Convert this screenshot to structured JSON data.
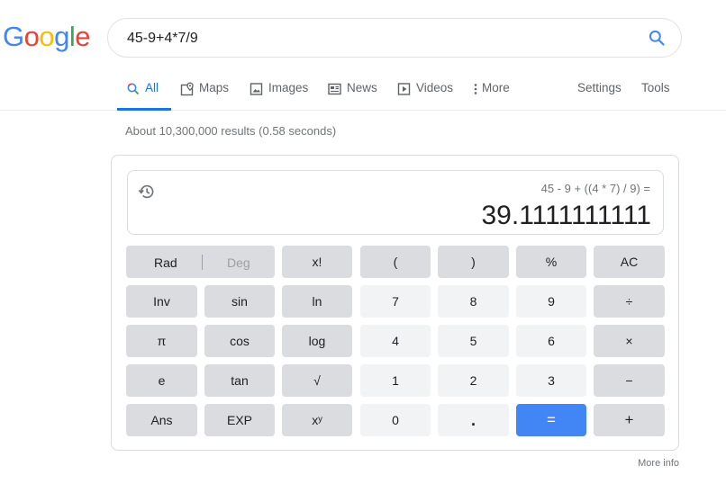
{
  "logo": {
    "letters": [
      "G",
      "o",
      "o",
      "g",
      "l",
      "e"
    ],
    "colors": [
      "#4285f4",
      "#ea4335",
      "#fbbc05",
      "#4285f4",
      "#34a853",
      "#ea4335"
    ]
  },
  "search": {
    "query": "45-9+4*7/9"
  },
  "tabs": [
    {
      "label": "All",
      "icon": "search-icon"
    },
    {
      "label": "Maps",
      "icon": "map-pin-icon"
    },
    {
      "label": "Images",
      "icon": "image-icon"
    },
    {
      "label": "News",
      "icon": "news-icon"
    },
    {
      "label": "Videos",
      "icon": "video-icon"
    },
    {
      "label": "More",
      "icon": "more-vert-icon"
    }
  ],
  "settings_label": "Settings",
  "tools_label": "Tools",
  "stats": "About 10,300,000 results (0.58 seconds)",
  "calculator": {
    "expression": "45 - 9 + ((4 * 7) / 9) =",
    "result": "39.1111111111",
    "rad_label": "Rad",
    "deg_label": "Deg",
    "keys": [
      [
        "x!",
        "(",
        ")",
        "%",
        "AC"
      ],
      [
        "Inv",
        "sin",
        "ln",
        "7",
        "8",
        "9",
        "÷"
      ],
      [
        "π",
        "cos",
        "log",
        "4",
        "5",
        "6",
        "×"
      ],
      [
        "e",
        "tan",
        "√",
        "1",
        "2",
        "3",
        "−"
      ],
      [
        "Ans",
        "EXP",
        "xʸ",
        "0",
        ".",
        "=",
        "+"
      ]
    ]
  },
  "more_info": "More info",
  "colors": {
    "accent": "#1a73e8",
    "equals": "#4285f4",
    "op_key": "#dadce0",
    "num_key": "#f1f3f4"
  }
}
